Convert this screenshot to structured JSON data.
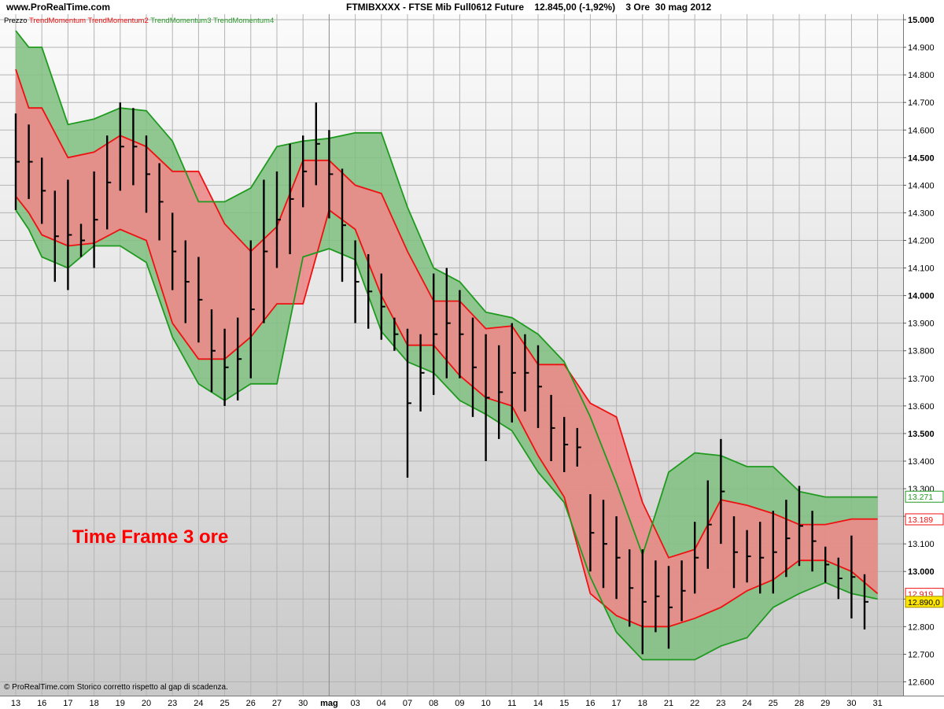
{
  "header": {
    "brand": "www.ProRealTime.com",
    "title": "FTMIBXXXX - FTSE Mib Full0612 Future    12.845,00 (-1,92%)    3 Ore  30 mag 2012"
  },
  "legend": {
    "prezzo": "Prezzo",
    "red_series": "TrendMomentum TrendMomentum2",
    "green_series": "TrendMomentum3 TrendMomentum4"
  },
  "annotation": "Time Frame 3 ore",
  "copyright": "© ProRealTime.com  Storico corretto rispetto al gap di scadenza.",
  "colors": {
    "red_line": "#ee1111",
    "green_line": "#1f9a1f",
    "red_fill": "#ec8a8a",
    "green_fill": "#7fbf7f",
    "bars": "#000000"
  },
  "chart_data": {
    "type": "line",
    "ylim": [
      12550,
      15020
    ],
    "y_ticks": [
      {
        "value": 15000,
        "label": "15.000",
        "bold": true
      },
      {
        "value": 14900,
        "label": "14.900",
        "bold": false
      },
      {
        "value": 14800,
        "label": "14.800",
        "bold": false
      },
      {
        "value": 14700,
        "label": "14.700",
        "bold": false
      },
      {
        "value": 14600,
        "label": "14.600",
        "bold": false
      },
      {
        "value": 14500,
        "label": "14.500",
        "bold": true
      },
      {
        "value": 14400,
        "label": "14.400",
        "bold": false
      },
      {
        "value": 14300,
        "label": "14.300",
        "bold": false
      },
      {
        "value": 14200,
        "label": "14.200",
        "bold": false
      },
      {
        "value": 14100,
        "label": "14.100",
        "bold": false
      },
      {
        "value": 14000,
        "label": "14.000",
        "bold": true
      },
      {
        "value": 13900,
        "label": "13.900",
        "bold": false
      },
      {
        "value": 13800,
        "label": "13.800",
        "bold": false
      },
      {
        "value": 13700,
        "label": "13.700",
        "bold": false
      },
      {
        "value": 13600,
        "label": "13.600",
        "bold": false
      },
      {
        "value": 13500,
        "label": "13.500",
        "bold": true
      },
      {
        "value": 13400,
        "label": "13.400",
        "bold": false
      },
      {
        "value": 13300,
        "label": "13.300",
        "bold": false
      },
      {
        "value": 13200,
        "label": "13.200",
        "bold": false
      },
      {
        "value": 13100,
        "label": "13.100",
        "bold": false
      },
      {
        "value": 13000,
        "label": "13.000",
        "bold": true
      },
      {
        "value": 12900,
        "label": "12.900",
        "bold": false
      },
      {
        "value": 12800,
        "label": "12.800",
        "bold": false
      },
      {
        "value": 12700,
        "label": "12.700",
        "bold": false
      },
      {
        "value": 12600,
        "label": "12.600",
        "bold": false
      }
    ],
    "x_labels": [
      "13",
      "16",
      "17",
      "18",
      "19",
      "20",
      "23",
      "24",
      "25",
      "26",
      "27",
      "30",
      "mag",
      "03",
      "04",
      "07",
      "08",
      "09",
      "10",
      "11",
      "14",
      "15",
      "16",
      "17",
      "18",
      "21",
      "22",
      "23",
      "24",
      "25",
      "28",
      "29",
      "30",
      "31"
    ],
    "month_separator_index": 12,
    "series": [
      {
        "name": "TrendMomentum",
        "color": "#ee1111",
        "values": [
          [
            0,
            14820
          ],
          [
            0.5,
            14680
          ],
          [
            1,
            14680
          ],
          [
            2,
            14500
          ],
          [
            3,
            14520
          ],
          [
            4,
            14580
          ],
          [
            5,
            14540
          ],
          [
            6,
            14450
          ],
          [
            7,
            14450
          ],
          [
            8,
            14260
          ],
          [
            9,
            14160
          ],
          [
            10,
            14250
          ],
          [
            11,
            14490
          ],
          [
            12,
            14490
          ],
          [
            13,
            14400
          ],
          [
            14,
            14370
          ],
          [
            15,
            14160
          ],
          [
            16,
            13980
          ],
          [
            17,
            13980
          ],
          [
            18,
            13880
          ],
          [
            19,
            13890
          ],
          [
            20,
            13750
          ],
          [
            21,
            13750
          ],
          [
            22,
            13610
          ],
          [
            23,
            13560
          ],
          [
            24,
            13250
          ],
          [
            25,
            13050
          ],
          [
            26,
            13080
          ],
          [
            27,
            13260
          ],
          [
            28,
            13240
          ],
          [
            29,
            13210
          ],
          [
            30,
            13170
          ],
          [
            31,
            13170
          ],
          [
            32,
            13190
          ],
          [
            33,
            13190
          ]
        ]
      },
      {
        "name": "TrendMomentum2",
        "color": "#ee1111",
        "values": [
          [
            0,
            14360
          ],
          [
            0.5,
            14300
          ],
          [
            1,
            14220
          ],
          [
            2,
            14180
          ],
          [
            3,
            14190
          ],
          [
            4,
            14240
          ],
          [
            5,
            14200
          ],
          [
            6,
            13900
          ],
          [
            7,
            13770
          ],
          [
            8,
            13770
          ],
          [
            9,
            13850
          ],
          [
            10,
            13970
          ],
          [
            11,
            13970
          ],
          [
            12,
            14310
          ],
          [
            13,
            14240
          ],
          [
            14,
            14000
          ],
          [
            15,
            13820
          ],
          [
            16,
            13820
          ],
          [
            17,
            13710
          ],
          [
            18,
            13630
          ],
          [
            19,
            13600
          ],
          [
            20,
            13420
          ],
          [
            21,
            13270
          ],
          [
            22,
            12920
          ],
          [
            23,
            12840
          ],
          [
            24,
            12800
          ],
          [
            25,
            12800
          ],
          [
            26,
            12830
          ],
          [
            27,
            12870
          ],
          [
            28,
            12930
          ],
          [
            29,
            12970
          ],
          [
            30,
            13040
          ],
          [
            31,
            13040
          ],
          [
            32,
            13000
          ],
          [
            33,
            12920
          ]
        ]
      },
      {
        "name": "TrendMomentum3",
        "color": "#1f9a1f",
        "values": [
          [
            0,
            14960
          ],
          [
            0.5,
            14900
          ],
          [
            1,
            14900
          ],
          [
            2,
            14620
          ],
          [
            3,
            14640
          ],
          [
            4,
            14680
          ],
          [
            5,
            14670
          ],
          [
            6,
            14560
          ],
          [
            7,
            14340
          ],
          [
            8,
            14340
          ],
          [
            9,
            14390
          ],
          [
            10,
            14540
          ],
          [
            11,
            14560
          ],
          [
            12,
            14570
          ],
          [
            13,
            14590
          ],
          [
            14,
            14590
          ],
          [
            15,
            14320
          ],
          [
            16,
            14100
          ],
          [
            17,
            14050
          ],
          [
            18,
            13940
          ],
          [
            19,
            13920
          ],
          [
            20,
            13860
          ],
          [
            21,
            13760
          ],
          [
            22,
            13560
          ],
          [
            23,
            13320
          ],
          [
            24,
            13060
          ],
          [
            25,
            13360
          ],
          [
            26,
            13430
          ],
          [
            27,
            13420
          ],
          [
            28,
            13380
          ],
          [
            29,
            13380
          ],
          [
            30,
            13290
          ],
          [
            31,
            13270
          ],
          [
            32,
            13270
          ],
          [
            33,
            13270
          ]
        ]
      },
      {
        "name": "TrendMomentum4",
        "color": "#1f9a1f",
        "values": [
          [
            0,
            14310
          ],
          [
            0.5,
            14240
          ],
          [
            1,
            14140
          ],
          [
            2,
            14100
          ],
          [
            3,
            14180
          ],
          [
            4,
            14180
          ],
          [
            5,
            14120
          ],
          [
            6,
            13850
          ],
          [
            7,
            13680
          ],
          [
            8,
            13620
          ],
          [
            9,
            13680
          ],
          [
            10,
            13680
          ],
          [
            11,
            14140
          ],
          [
            12,
            14170
          ],
          [
            13,
            14130
          ],
          [
            14,
            13870
          ],
          [
            15,
            13760
          ],
          [
            16,
            13720
          ],
          [
            17,
            13620
          ],
          [
            18,
            13570
          ],
          [
            19,
            13510
          ],
          [
            20,
            13360
          ],
          [
            21,
            13250
          ],
          [
            22,
            12980
          ],
          [
            23,
            12780
          ],
          [
            24,
            12680
          ],
          [
            25,
            12680
          ],
          [
            26,
            12680
          ],
          [
            27,
            12730
          ],
          [
            28,
            12760
          ],
          [
            29,
            12870
          ],
          [
            30,
            12920
          ],
          [
            31,
            12960
          ],
          [
            32,
            12920
          ],
          [
            33,
            12900
          ]
        ]
      }
    ],
    "price_bars": [
      [
        0,
        14660,
        14310
      ],
      [
        0.5,
        14620,
        14350
      ],
      [
        1,
        14500,
        14260
      ],
      [
        1.5,
        14380,
        14050
      ],
      [
        2,
        14420,
        14020
      ],
      [
        2.5,
        14260,
        14140
      ],
      [
        3,
        14450,
        14100
      ],
      [
        3.5,
        14580,
        14240
      ],
      [
        4,
        14700,
        14380
      ],
      [
        4.5,
        14680,
        14400
      ],
      [
        5,
        14580,
        14300
      ],
      [
        5.5,
        14480,
        14200
      ],
      [
        6,
        14300,
        14020
      ],
      [
        6.5,
        14200,
        13900
      ],
      [
        7,
        14140,
        13830
      ],
      [
        7.5,
        13950,
        13650
      ],
      [
        8,
        13880,
        13600
      ],
      [
        8.5,
        13920,
        13620
      ],
      [
        9,
        14200,
        13700
      ],
      [
        9.5,
        14420,
        13900
      ],
      [
        10,
        14450,
        14100
      ],
      [
        10.5,
        14550,
        14150
      ],
      [
        11,
        14580,
        14320
      ],
      [
        11.5,
        14700,
        14400
      ],
      [
        12,
        14600,
        14280
      ],
      [
        12.5,
        14460,
        14050
      ],
      [
        13,
        14200,
        13900
      ],
      [
        13.5,
        14150,
        13880
      ],
      [
        14,
        14080,
        13840
      ],
      [
        14.5,
        13920,
        13800
      ],
      [
        15,
        13880,
        13340
      ],
      [
        15.5,
        13860,
        13580
      ],
      [
        16,
        14080,
        13640
      ],
      [
        16.5,
        14100,
        13700
      ],
      [
        17,
        14020,
        13700
      ],
      [
        17.5,
        13920,
        13560
      ],
      [
        18,
        13860,
        13400
      ],
      [
        18.5,
        13820,
        13480
      ],
      [
        19,
        13900,
        13540
      ],
      [
        19.5,
        13860,
        13580
      ],
      [
        20,
        13820,
        13520
      ],
      [
        20.5,
        13640,
        13400
      ],
      [
        21,
        13560,
        13360
      ],
      [
        21.5,
        13520,
        13380
      ],
      [
        22,
        13280,
        13000
      ],
      [
        22.5,
        13260,
        12940
      ],
      [
        23,
        13200,
        12900
      ],
      [
        23.5,
        13080,
        12800
      ],
      [
        24,
        13080,
        12700
      ],
      [
        24.5,
        13040,
        12780
      ],
      [
        25,
        13020,
        12720
      ],
      [
        25.5,
        13040,
        12820
      ],
      [
        26,
        13180,
        12920
      ],
      [
        26.5,
        13330,
        13010
      ],
      [
        27,
        13480,
        13100
      ],
      [
        27.5,
        13200,
        12940
      ],
      [
        28,
        13150,
        12960
      ],
      [
        28.5,
        13180,
        12920
      ],
      [
        29,
        13220,
        12920
      ],
      [
        29.5,
        13260,
        12980
      ],
      [
        30,
        13310,
        13020
      ],
      [
        30.5,
        13220,
        13000
      ],
      [
        31,
        13090,
        12960
      ],
      [
        31.5,
        13050,
        12900
      ],
      [
        32,
        13130,
        12830
      ],
      [
        32.5,
        12990,
        12790
      ]
    ],
    "right_labels": [
      {
        "value": 13271,
        "label": "13.271",
        "style": "green"
      },
      {
        "value": 13189,
        "label": "13.189",
        "style": "red"
      },
      {
        "value": 12919,
        "label": "12.919",
        "style": "red"
      },
      {
        "value": 12890,
        "label": "12.890,0",
        "style": "current"
      }
    ]
  }
}
